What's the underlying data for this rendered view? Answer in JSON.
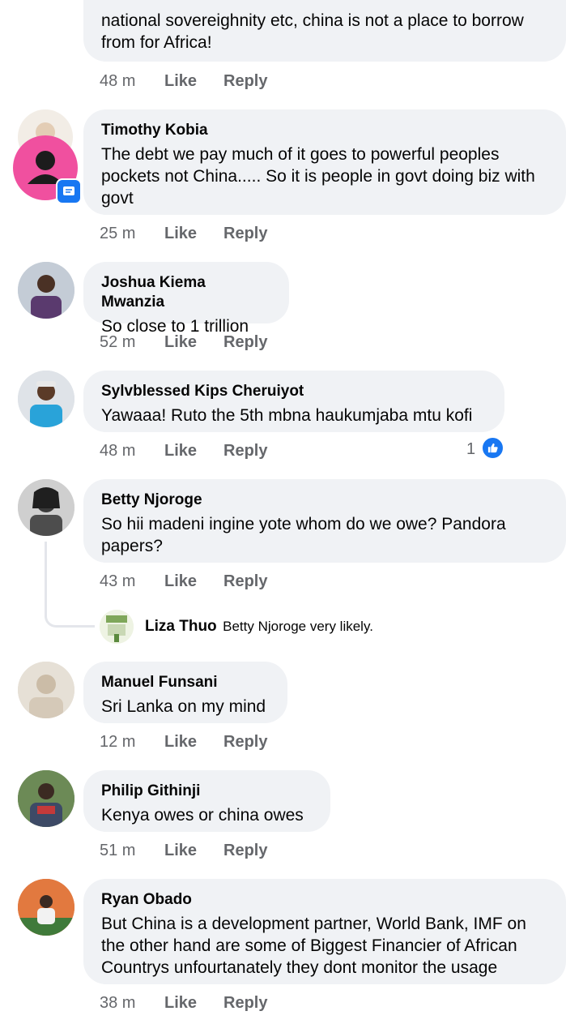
{
  "comments": [
    {
      "name": "",
      "text": "national sovereighnity etc, china is not a place to borrow from for Africa!",
      "time": "48 m",
      "like": "Like",
      "reply": "Reply"
    },
    {
      "name": "Timothy Kobia",
      "text": "The debt we pay much of it goes to powerful peoples pockets not China..... So it is people in govt doing biz with govt",
      "time": "25 m",
      "like": "Like",
      "reply": "Reply"
    },
    {
      "name": "Joshua Kiema Mwanzia",
      "text": "So close to 1 trillion",
      "time": "52 m",
      "like": "Like",
      "reply": "Reply"
    },
    {
      "name": "Sylvblessed Kips Cheruiyot",
      "text": "Yawaaa! Ruto the 5th mbna haukumjaba mtu kofi",
      "time": "48 m",
      "like": "Like",
      "reply": "Reply",
      "reaction_count": "1"
    },
    {
      "name": "Betty Njoroge",
      "text": "So hii madeni ingine yote whom do we owe? Pandora papers?",
      "time": "43 m",
      "like": "Like",
      "reply": "Reply"
    },
    {
      "name": "Manuel Funsani",
      "text": "Sri Lanka on my mind",
      "time": "12 m",
      "like": "Like",
      "reply": "Reply"
    },
    {
      "name": "Philip Githinji",
      "text": "Kenya owes or china owes",
      "time": "51 m",
      "like": "Like",
      "reply": "Reply"
    },
    {
      "name": "Ryan Obado",
      "text": "But China is a development partner, World Bank, IMF on the other hand are some of Biggest Financier of African Countrys unfourtanately they dont monitor the usage",
      "time": "38 m",
      "like": "Like",
      "reply": "Reply"
    }
  ],
  "reply_preview": {
    "name": "Liza Thuo",
    "text": "Betty Njoroge very likely."
  },
  "colors": {
    "bubble": "#f0f2f5",
    "meta": "#65676b",
    "like_blue": "#1877f2",
    "avatar_pink": "#f0509f"
  },
  "icons": [
    "default-avatar-icon",
    "messenger-badge-icon",
    "like-reaction-icon"
  ]
}
